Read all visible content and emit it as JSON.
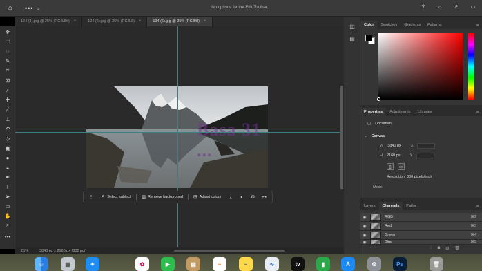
{
  "appbar": {
    "home_icon": "home-icon",
    "menu_dots": "•••",
    "message": "No options for the Edit Toolbar...",
    "right_icons": [
      "share-icon",
      "lightbulb-icon",
      "search-icon",
      "workspace-icon"
    ]
  },
  "tabs": [
    {
      "label": "194 (4).jpg @ 25% (RGB/8#)",
      "active": false
    },
    {
      "label": "194 (5).jpg @ 25% (RGB/8)",
      "active": false
    },
    {
      "label": "194 (6).jpg @ 25% (RGB/8)",
      "active": true
    }
  ],
  "tools": [
    "move-icon",
    "artboard-icon",
    "lasso-icon",
    "quick-select-icon",
    "crop-icon",
    "frame-icon",
    "eyedropper-icon",
    "spot-heal-icon",
    "brush-icon",
    "stamp-icon",
    "history-brush-icon",
    "eraser-icon",
    "gradient-icon",
    "blur-icon",
    "dodge-icon",
    "pen-icon",
    "type-icon",
    "path-select-icon",
    "rectangle-icon",
    "hand-icon",
    "zoom-icon"
  ],
  "canvas": {
    "watermark": "Ваsa 31 ..."
  },
  "context_bar": {
    "select_subject": "Select subject",
    "remove_background": "Remove background",
    "adjust_colors": "Adjust colors",
    "more": "•••"
  },
  "status": {
    "zoom": "25%",
    "dimensions": "3840 px x 2160 px (300 ppi)"
  },
  "color_panel": {
    "tabs": [
      "Color",
      "Swatches",
      "Gradients",
      "Patterns"
    ],
    "foreground": "#000000",
    "background": "#ffffff"
  },
  "properties_panel": {
    "tabs": [
      "Properties",
      "Adjustments",
      "Libraries"
    ],
    "type": "Document",
    "section": "Canvas",
    "w_label": "W",
    "w_value": "3840 px",
    "x_label": "X",
    "h_label": "H",
    "h_value": "2160 px",
    "y_label": "Y",
    "resolution": "Resolution: 300 pixels/inch",
    "mode": "Mode"
  },
  "channels_panel": {
    "tabs": [
      "Layers",
      "Channels",
      "Paths"
    ],
    "rows": [
      {
        "name": "RGB",
        "shortcut": "⌘2"
      },
      {
        "name": "Red",
        "shortcut": "⌘3"
      },
      {
        "name": "Green",
        "shortcut": "⌘4"
      },
      {
        "name": "Blue",
        "shortcut": "⌘5"
      }
    ]
  },
  "dock_apps": [
    "Finder",
    "Launchpad",
    "Safari",
    "Photos",
    "FaceTime",
    "Notes",
    "Reminders",
    "Notes",
    "Freeform",
    "TV",
    "Numbers",
    "App Store",
    "System Settings",
    "Photoshop",
    "Trash"
  ]
}
